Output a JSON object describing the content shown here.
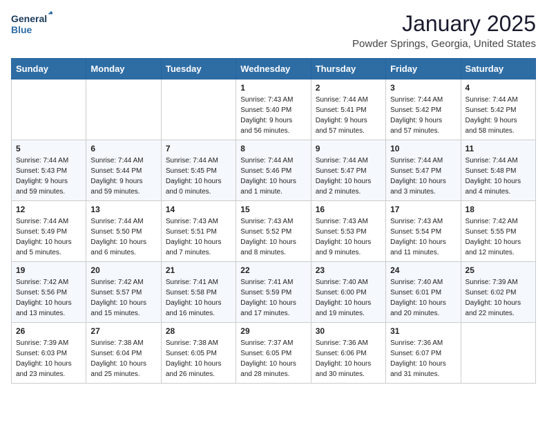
{
  "header": {
    "logo": {
      "line1": "General",
      "line2": "Blue"
    },
    "title": "January 2025",
    "location": "Powder Springs, Georgia, United States"
  },
  "weekdays": [
    "Sunday",
    "Monday",
    "Tuesday",
    "Wednesday",
    "Thursday",
    "Friday",
    "Saturday"
  ],
  "weeks": [
    [
      {
        "day": "",
        "info": ""
      },
      {
        "day": "",
        "info": ""
      },
      {
        "day": "",
        "info": ""
      },
      {
        "day": "1",
        "info": "Sunrise: 7:43 AM\nSunset: 5:40 PM\nDaylight: 9 hours\nand 56 minutes."
      },
      {
        "day": "2",
        "info": "Sunrise: 7:44 AM\nSunset: 5:41 PM\nDaylight: 9 hours\nand 57 minutes."
      },
      {
        "day": "3",
        "info": "Sunrise: 7:44 AM\nSunset: 5:42 PM\nDaylight: 9 hours\nand 57 minutes."
      },
      {
        "day": "4",
        "info": "Sunrise: 7:44 AM\nSunset: 5:42 PM\nDaylight: 9 hours\nand 58 minutes."
      }
    ],
    [
      {
        "day": "5",
        "info": "Sunrise: 7:44 AM\nSunset: 5:43 PM\nDaylight: 9 hours\nand 59 minutes."
      },
      {
        "day": "6",
        "info": "Sunrise: 7:44 AM\nSunset: 5:44 PM\nDaylight: 9 hours\nand 59 minutes."
      },
      {
        "day": "7",
        "info": "Sunrise: 7:44 AM\nSunset: 5:45 PM\nDaylight: 10 hours\nand 0 minutes."
      },
      {
        "day": "8",
        "info": "Sunrise: 7:44 AM\nSunset: 5:46 PM\nDaylight: 10 hours\nand 1 minute."
      },
      {
        "day": "9",
        "info": "Sunrise: 7:44 AM\nSunset: 5:47 PM\nDaylight: 10 hours\nand 2 minutes."
      },
      {
        "day": "10",
        "info": "Sunrise: 7:44 AM\nSunset: 5:47 PM\nDaylight: 10 hours\nand 3 minutes."
      },
      {
        "day": "11",
        "info": "Sunrise: 7:44 AM\nSunset: 5:48 PM\nDaylight: 10 hours\nand 4 minutes."
      }
    ],
    [
      {
        "day": "12",
        "info": "Sunrise: 7:44 AM\nSunset: 5:49 PM\nDaylight: 10 hours\nand 5 minutes."
      },
      {
        "day": "13",
        "info": "Sunrise: 7:44 AM\nSunset: 5:50 PM\nDaylight: 10 hours\nand 6 minutes."
      },
      {
        "day": "14",
        "info": "Sunrise: 7:43 AM\nSunset: 5:51 PM\nDaylight: 10 hours\nand 7 minutes."
      },
      {
        "day": "15",
        "info": "Sunrise: 7:43 AM\nSunset: 5:52 PM\nDaylight: 10 hours\nand 8 minutes."
      },
      {
        "day": "16",
        "info": "Sunrise: 7:43 AM\nSunset: 5:53 PM\nDaylight: 10 hours\nand 9 minutes."
      },
      {
        "day": "17",
        "info": "Sunrise: 7:43 AM\nSunset: 5:54 PM\nDaylight: 10 hours\nand 11 minutes."
      },
      {
        "day": "18",
        "info": "Sunrise: 7:42 AM\nSunset: 5:55 PM\nDaylight: 10 hours\nand 12 minutes."
      }
    ],
    [
      {
        "day": "19",
        "info": "Sunrise: 7:42 AM\nSunset: 5:56 PM\nDaylight: 10 hours\nand 13 minutes."
      },
      {
        "day": "20",
        "info": "Sunrise: 7:42 AM\nSunset: 5:57 PM\nDaylight: 10 hours\nand 15 minutes."
      },
      {
        "day": "21",
        "info": "Sunrise: 7:41 AM\nSunset: 5:58 PM\nDaylight: 10 hours\nand 16 minutes."
      },
      {
        "day": "22",
        "info": "Sunrise: 7:41 AM\nSunset: 5:59 PM\nDaylight: 10 hours\nand 17 minutes."
      },
      {
        "day": "23",
        "info": "Sunrise: 7:40 AM\nSunset: 6:00 PM\nDaylight: 10 hours\nand 19 minutes."
      },
      {
        "day": "24",
        "info": "Sunrise: 7:40 AM\nSunset: 6:01 PM\nDaylight: 10 hours\nand 20 minutes."
      },
      {
        "day": "25",
        "info": "Sunrise: 7:39 AM\nSunset: 6:02 PM\nDaylight: 10 hours\nand 22 minutes."
      }
    ],
    [
      {
        "day": "26",
        "info": "Sunrise: 7:39 AM\nSunset: 6:03 PM\nDaylight: 10 hours\nand 23 minutes."
      },
      {
        "day": "27",
        "info": "Sunrise: 7:38 AM\nSunset: 6:04 PM\nDaylight: 10 hours\nand 25 minutes."
      },
      {
        "day": "28",
        "info": "Sunrise: 7:38 AM\nSunset: 6:05 PM\nDaylight: 10 hours\nand 26 minutes."
      },
      {
        "day": "29",
        "info": "Sunrise: 7:37 AM\nSunset: 6:05 PM\nDaylight: 10 hours\nand 28 minutes."
      },
      {
        "day": "30",
        "info": "Sunrise: 7:36 AM\nSunset: 6:06 PM\nDaylight: 10 hours\nand 30 minutes."
      },
      {
        "day": "31",
        "info": "Sunrise: 7:36 AM\nSunset: 6:07 PM\nDaylight: 10 hours\nand 31 minutes."
      },
      {
        "day": "",
        "info": ""
      }
    ]
  ]
}
